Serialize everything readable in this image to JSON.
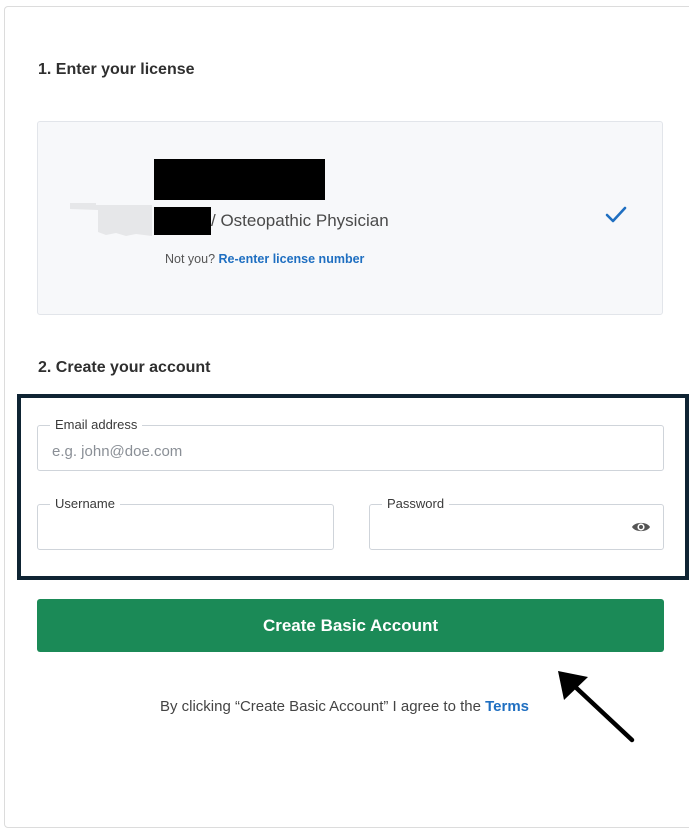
{
  "step1": {
    "title": "1. Enter your license"
  },
  "license": {
    "type_text": "/ Osteopathic Physician",
    "not_you_prefix": "Not you?",
    "reenter_link": "Re-enter license number",
    "verified_icon": "check-icon",
    "state_icon": "oklahoma-state-shape"
  },
  "step2": {
    "title": "2. Create your account"
  },
  "form": {
    "email": {
      "label": "Email address",
      "placeholder": "e.g. john@doe.com",
      "value": ""
    },
    "username": {
      "label": "Username",
      "value": ""
    },
    "password": {
      "label": "Password",
      "value": "",
      "toggle_icon": "eye-icon"
    }
  },
  "submit": {
    "label": "Create Basic Account"
  },
  "terms": {
    "prefix": "By clicking “Create Basic Account” I agree to the",
    "link": "Terms"
  },
  "colors": {
    "primary_button": "#1b8a57",
    "link": "#1f6fc1",
    "check": "#1f6fc1",
    "highlight_border": "#0f2433"
  }
}
